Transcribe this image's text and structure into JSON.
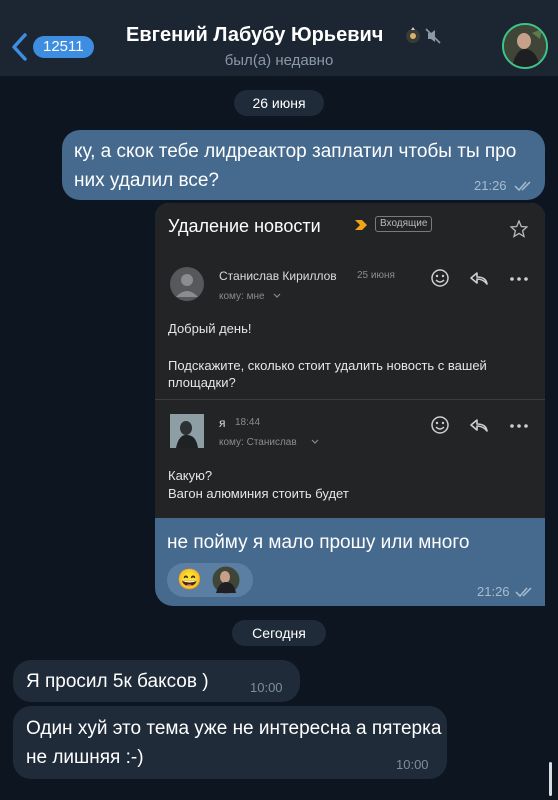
{
  "header": {
    "back_count": "12511",
    "contact_name": "Евгений Лабубу Юрьевич",
    "status": "был(а) недавно"
  },
  "dates": {
    "first": "26 июня",
    "second": "Сегодня"
  },
  "messages": {
    "out1": {
      "text": "ку, а скок тебе лидреактор заплатил чтобы ты про них удалил все?",
      "time": "21:26"
    },
    "out2": {
      "text": "не пойму я мало прошу или много",
      "time": "21:26"
    },
    "in1": {
      "text": "Я просил 5к баксов )",
      "time": "10:00"
    },
    "in2": {
      "text": "Один хуй это тема уже не интересна а пятерка не лишняя :-)",
      "time": "10:00"
    }
  },
  "email": {
    "subject": "Удаление новости",
    "folder_tag": "Входящие",
    "first": {
      "sender": "Станислав Кириллов",
      "date": "25 июня",
      "to": "кому: мне",
      "greeting": "Добрый день!",
      "body": "Подскажите, сколько стоит удалить новость с вашей площадки?"
    },
    "second": {
      "sender": "я",
      "time": "18:44",
      "to": "кому: Станислав",
      "line1": "Какую?",
      "line2": "Вагон алюминия стоить будет"
    }
  },
  "reaction": {
    "emoji": "😄"
  },
  "colors": {
    "accent": "#3d8de0",
    "bubble_out": "#456a8e",
    "bubble_in": "#1f2b38",
    "background": "#0d1521"
  }
}
